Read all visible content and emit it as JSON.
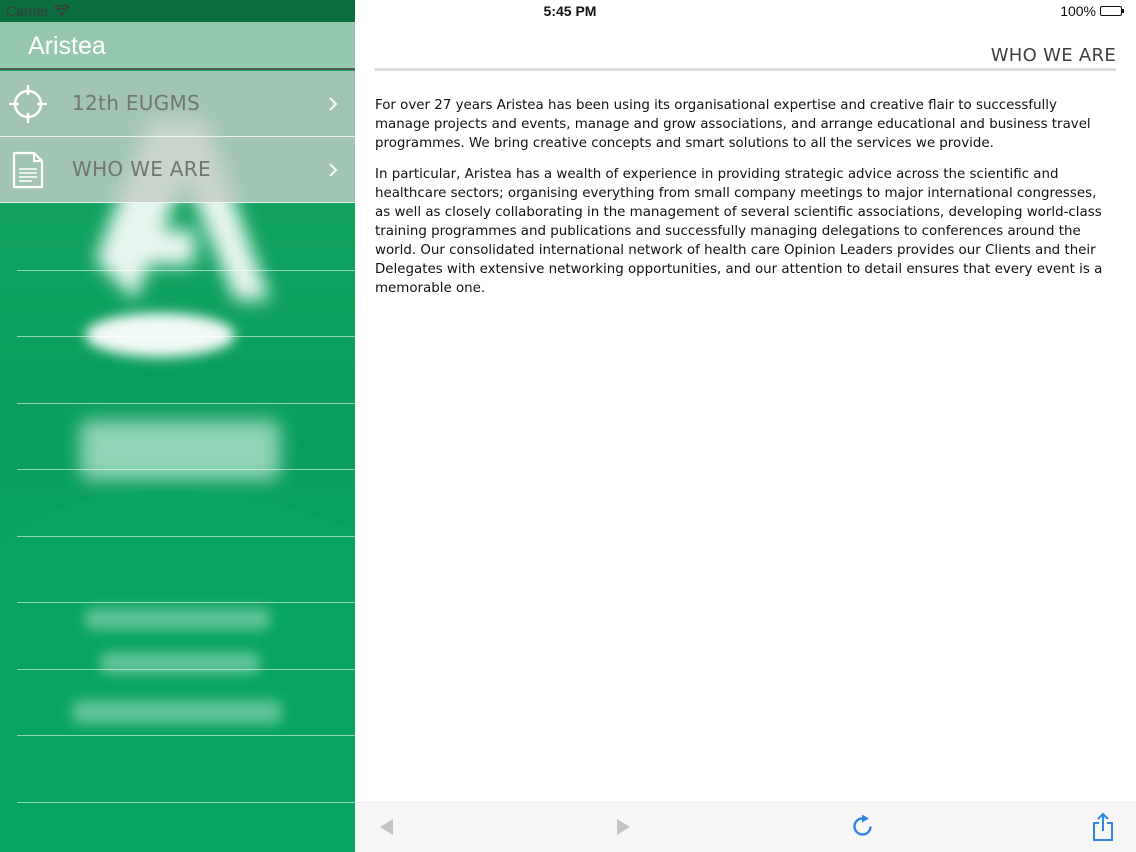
{
  "status_bar": {
    "carrier": "Carrier",
    "time": "5:45 PM",
    "battery": "100%"
  },
  "sidebar": {
    "title": "Aristea",
    "items": [
      {
        "label": "12th EUGMS",
        "icon": "crosshair-icon"
      },
      {
        "label": "WHO WE ARE",
        "icon": "document-icon"
      }
    ]
  },
  "main": {
    "page_title": "WHO WE ARE",
    "paragraphs": [
      "For over 27 years Aristea has been using its organisational expertise and creative flair to successfully manage projects and events, manage and grow associations, and arrange educational and business travel programmes. We bring creative concepts and smart solutions to all the services we provide.",
      "In particular, Aristea has a wealth of experience in providing strategic advice across the scientific and healthcare sectors; organising everything from small company meetings to major international congresses, as well as closely collaborating in the management of several scientific associations, developing world-class training programmes and publications and successfully managing delegations to conferences around the world. Our consolidated international network of health care Opinion Leaders provides our Clients and their Delegates with extensive networking opportunities, and our attention to detail ensures that every event is a memorable one."
    ]
  },
  "toolbar": {
    "back_icon": "back-arrow-icon",
    "forward_icon": "forward-arrow-icon",
    "reload_icon": "reload-icon",
    "share_icon": "share-icon"
  },
  "colors": {
    "sidebar_green": "#0a9e5c",
    "accent_blue": "#2f86e6",
    "disabled_gray": "#c4c4c4"
  }
}
